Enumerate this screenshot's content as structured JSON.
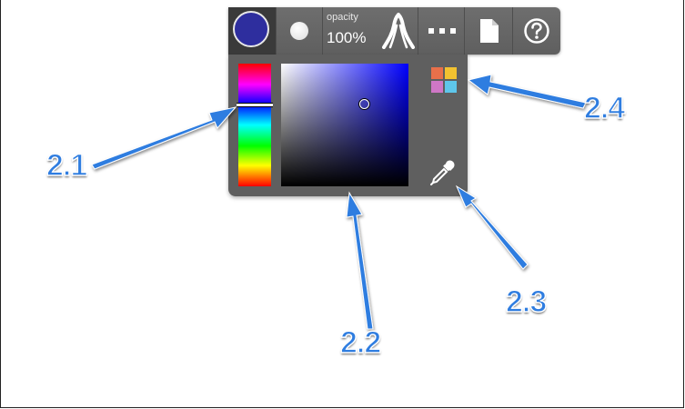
{
  "toolbar": {
    "current_color": "#2e2e9e",
    "opacity_label": "opacity",
    "opacity_value": "100%",
    "icons": {
      "color": "current-color-icon",
      "brush": "brush-size-icon",
      "pressure": "pressure-curve-icon",
      "more": "more-icon",
      "document": "document-icon",
      "help": "help-icon"
    }
  },
  "color_picker": {
    "hue": "blue",
    "hue_color": "#0000ff",
    "icons": {
      "palette": "palette-icon",
      "eyedropper": "eyedropper-icon"
    },
    "palette_colors": [
      "#e8704a",
      "#f2c230",
      "#cf77c6",
      "#5ec6ea"
    ]
  },
  "annotations": [
    {
      "label": "2.1",
      "target": "hue-slider"
    },
    {
      "label": "2.2",
      "target": "saturation-value-square"
    },
    {
      "label": "2.3",
      "target": "eyedropper-button"
    },
    {
      "label": "2.4",
      "target": "palette-button"
    }
  ],
  "colors": {
    "annotation_blue": "#2f7de0",
    "toolbar_gray": "#666666"
  }
}
